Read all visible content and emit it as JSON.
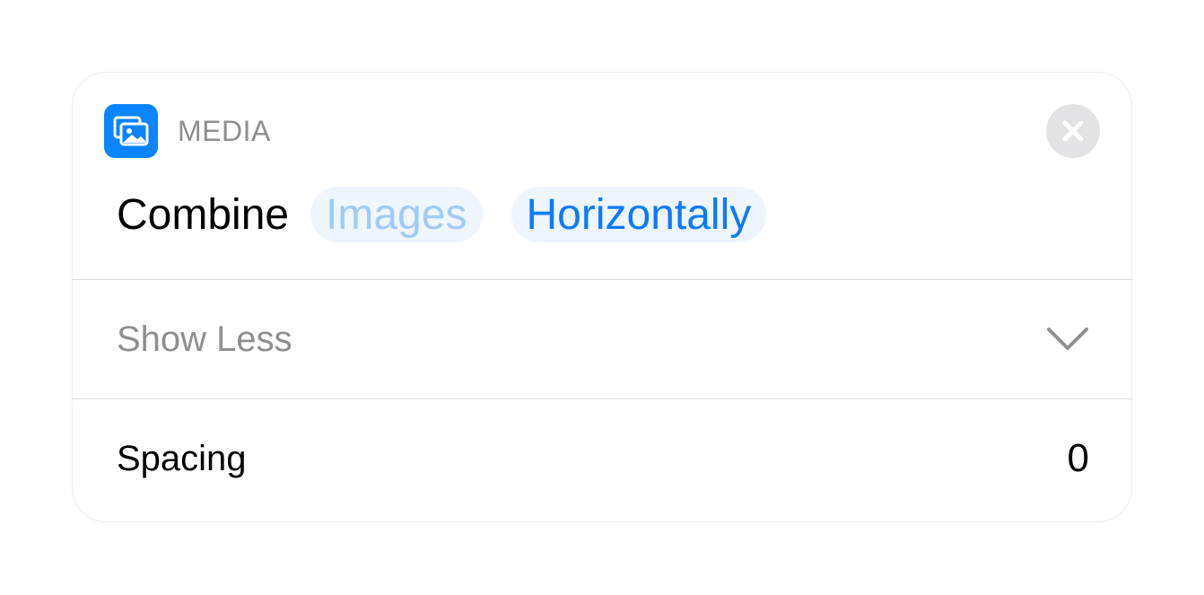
{
  "action": {
    "category": "MEDIA",
    "verb": "Combine",
    "input_placeholder": "Images",
    "mode_value": "Horizontally",
    "app_icon": "photos-stack-icon",
    "close_icon": "close-icon"
  },
  "disclosure": {
    "label": "Show Less",
    "icon": "chevron-down-icon"
  },
  "parameters": [
    {
      "label": "Spacing",
      "value": "0"
    }
  ],
  "colors": {
    "accent": "#0a84ff",
    "token_bg": "#eef5fd",
    "placeholder_text": "#9fcbf7",
    "secondary_text": "#8e8e93",
    "close_bg": "#e3e3e6"
  }
}
